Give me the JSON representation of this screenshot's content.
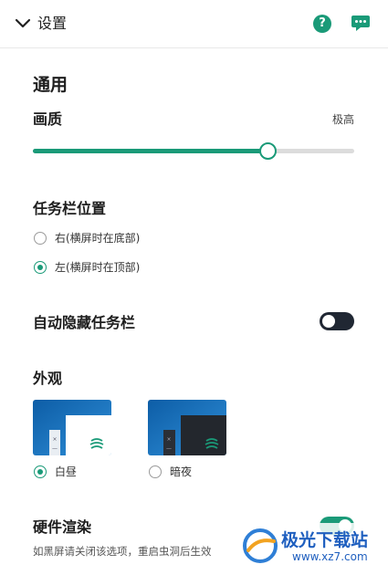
{
  "header": {
    "title": "设置",
    "help_glyph": "?",
    "icons": [
      "chevron-down-icon",
      "help-icon",
      "feedback-chat-icon"
    ]
  },
  "general": {
    "title": "通用",
    "quality": {
      "label": "画质",
      "value_label": "极高",
      "level_fraction": 0.73
    }
  },
  "taskbar_position": {
    "title": "任务栏位置",
    "options": [
      {
        "label": "右(横屏时在底部)",
        "selected": false
      },
      {
        "label": "左(横屏时在顶部)",
        "selected": true
      }
    ]
  },
  "auto_hide": {
    "label": "自动隐藏任务栏",
    "enabled": false
  },
  "appearance": {
    "title": "外观",
    "options": [
      {
        "label": "白昼",
        "selected": true
      },
      {
        "label": "暗夜",
        "selected": false
      }
    ]
  },
  "hardware": {
    "label": "硬件渲染",
    "note": "如黑屏请关闭该选项，重启虫洞后生效",
    "enabled": true
  },
  "watermark": {
    "text": "极光下载站",
    "url": "www.xz7.com"
  },
  "colors": {
    "accent": "#1a9a78",
    "dark_toggle": "#202733"
  }
}
